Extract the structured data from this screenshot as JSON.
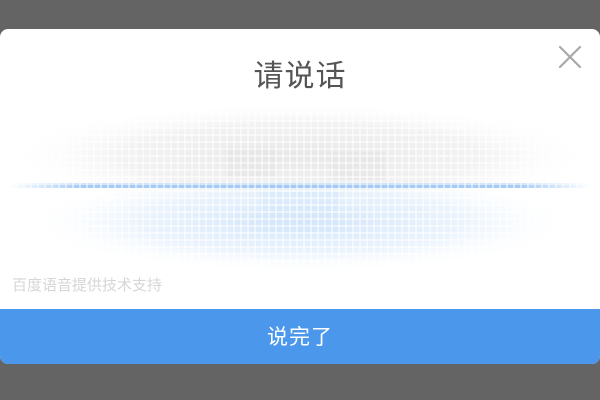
{
  "dialog": {
    "title": "请说话",
    "credit": "百度语音提供技术支持",
    "done_label": "说完了",
    "close_icon": "close-icon"
  },
  "colors": {
    "overlay": "#646464",
    "accent": "#4a97ec",
    "waveform": "#9cc6f5"
  }
}
